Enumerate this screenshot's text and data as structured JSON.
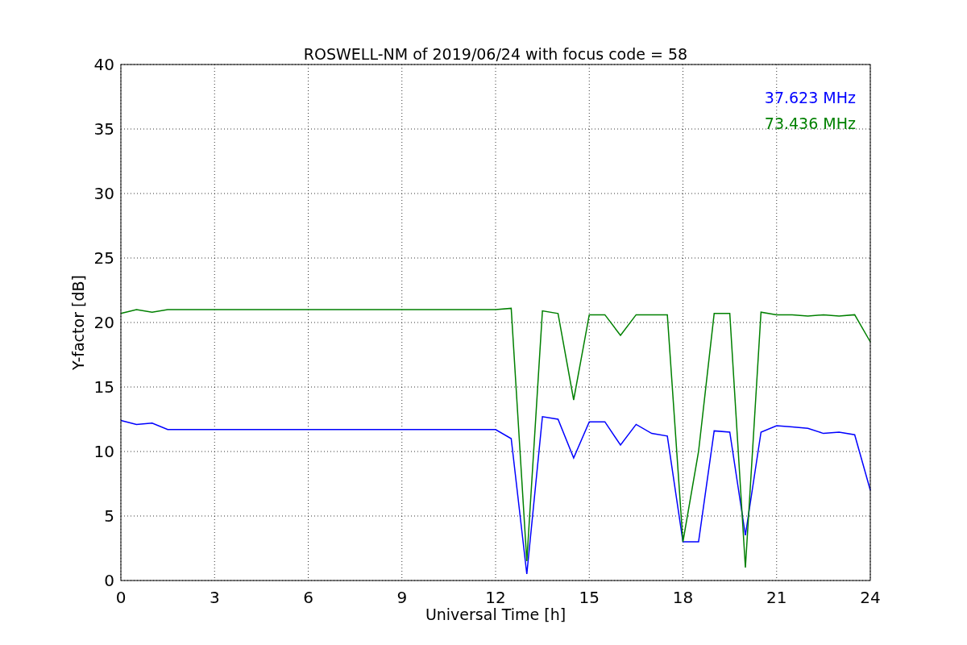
{
  "chart_data": {
    "type": "line",
    "title": "ROSWELL-NM of 2019/06/24 with focus code = 58",
    "xlabel": "Universal Time [h]",
    "ylabel": "Y-factor [dB]",
    "x": [
      0,
      0.5,
      1,
      1.5,
      2,
      2.5,
      3,
      3.5,
      4,
      4.5,
      5,
      5.5,
      6,
      6.5,
      7,
      7.5,
      8,
      8.5,
      9,
      9.5,
      10,
      10.5,
      11,
      11.5,
      12,
      12.5,
      13,
      13.5,
      14,
      14.5,
      15,
      15.5,
      16,
      16.5,
      17,
      17.5,
      18,
      18.5,
      19,
      19.5,
      20,
      20.5,
      21,
      21.5,
      22,
      22.5,
      23,
      23.5,
      24
    ],
    "series": [
      {
        "name": "37.623 MHz",
        "color": "#0000ff",
        "values": [
          12.4,
          12.1,
          12.2,
          11.7,
          11.7,
          11.7,
          11.7,
          11.7,
          11.7,
          11.7,
          11.7,
          11.7,
          11.7,
          11.7,
          11.7,
          11.7,
          11.7,
          11.7,
          11.7,
          11.7,
          11.7,
          11.7,
          11.7,
          11.7,
          11.7,
          11.0,
          0.5,
          12.7,
          12.5,
          9.5,
          12.3,
          12.3,
          10.5,
          12.1,
          11.4,
          11.2,
          3.0,
          3.0,
          11.6,
          11.5,
          3.5,
          11.5,
          12.0,
          11.9,
          11.8,
          11.4,
          11.5,
          11.3,
          7.0
        ]
      },
      {
        "name": "73.436 MHz",
        "color": "#008000",
        "values": [
          20.7,
          21.0,
          20.8,
          21.0,
          21.0,
          21.0,
          21.0,
          21.0,
          21.0,
          21.0,
          21.0,
          21.0,
          21.0,
          21.0,
          21.0,
          21.0,
          21.0,
          21.0,
          21.0,
          21.0,
          21.0,
          21.0,
          21.0,
          21.0,
          21.0,
          21.1,
          1.5,
          20.9,
          20.7,
          14.0,
          20.6,
          20.6,
          19.0,
          20.6,
          20.6,
          20.6,
          3.0,
          10.0,
          20.7,
          20.7,
          1.0,
          20.8,
          20.6,
          20.6,
          20.5,
          20.6,
          20.5,
          20.6,
          18.5
        ]
      }
    ],
    "xlim": [
      0,
      24
    ],
    "ylim": [
      0,
      40
    ],
    "xticks": [
      0,
      3,
      6,
      9,
      12,
      15,
      18,
      21,
      24
    ],
    "yticks": [
      0,
      5,
      10,
      15,
      20,
      25,
      30,
      35,
      40
    ],
    "grid": true
  }
}
